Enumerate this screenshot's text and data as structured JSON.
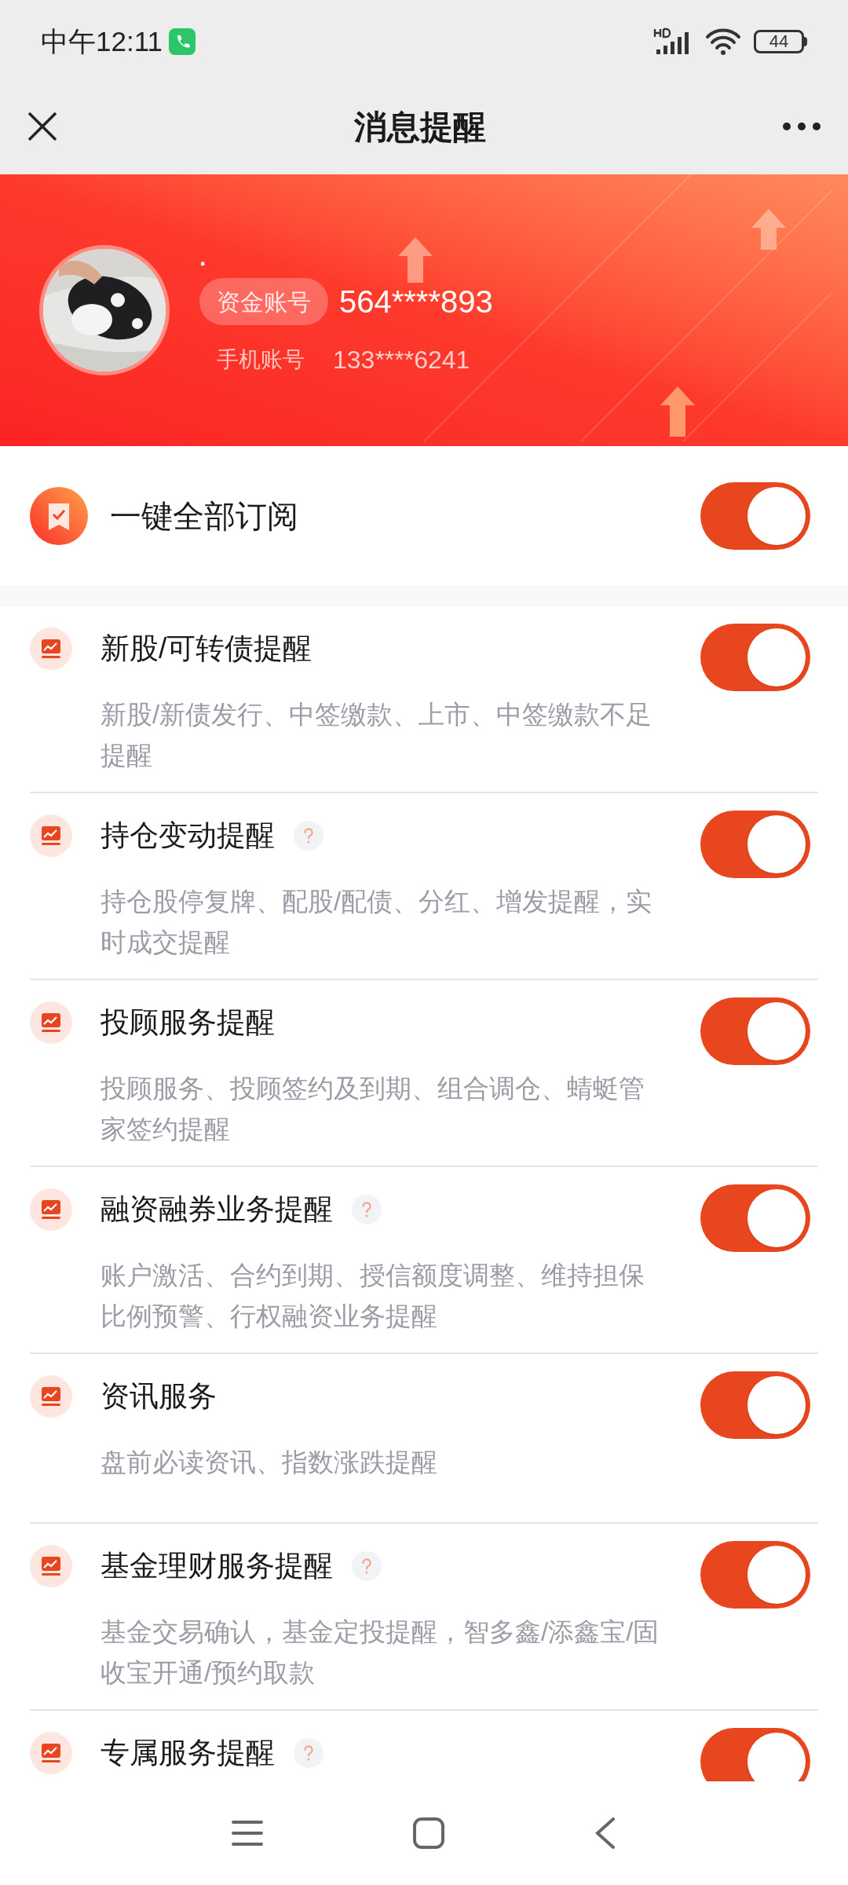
{
  "status_bar": {
    "time": "中午12:11",
    "battery": "44"
  },
  "title_bar": {
    "title": "消息提醒"
  },
  "profile": {
    "name": ".",
    "account_label": "资金账号",
    "account_number": "564****893",
    "phone_label": "手机账号",
    "phone_number": "133****6241"
  },
  "subscribe_all": {
    "label": "一键全部订阅",
    "on": true
  },
  "items": [
    {
      "title": "新股/可转债提醒",
      "help": false,
      "description": "新股/新债发行、中签缴款、上市、中签缴款不足提醒",
      "on": true
    },
    {
      "title": "持仓变动提醒",
      "help": true,
      "description": "持仓股停复牌、配股/配债、分红、增发提醒，实时成交提醒",
      "on": true
    },
    {
      "title": "投顾服务提醒",
      "help": false,
      "description": "投顾服务、投顾签约及到期、组合调仓、蜻蜓管家签约提醒",
      "on": true
    },
    {
      "title": "融资融券业务提醒",
      "help": true,
      "description": "账户激活、合约到期、授信额度调整、维持担保比例预警、行权融资业务提醒",
      "on": true
    },
    {
      "title": "资讯服务",
      "help": false,
      "description": "盘前必读资讯、指数涨跌提醒",
      "on": true
    },
    {
      "title": "基金理财服务提醒",
      "help": true,
      "description": "基金交易确认，基金定投提醒，智多鑫/添鑫宝/固收宝开通/预约取款",
      "on": true
    },
    {
      "title": "专属服务提醒",
      "help": true,
      "on": true
    }
  ]
}
